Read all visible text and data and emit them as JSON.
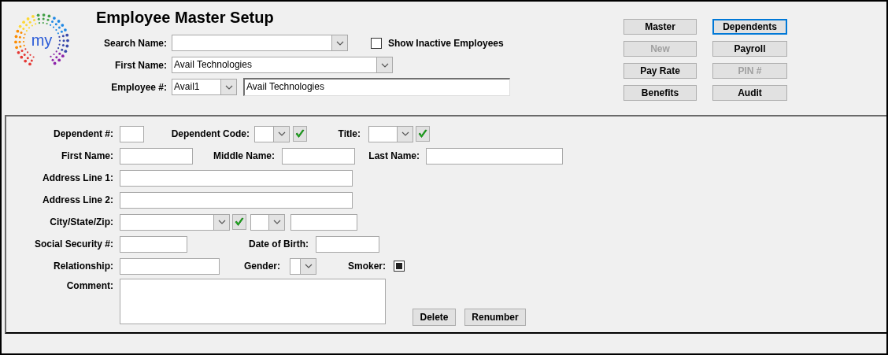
{
  "logo": {
    "text": "my"
  },
  "title": "Employee Master Setup",
  "search": {
    "label": "Search Name:"
  },
  "show_inactive": {
    "label": "Show Inactive Employees",
    "checked": false
  },
  "first_name": {
    "label": "First Name:",
    "value": "Avail Technologies"
  },
  "employee": {
    "label": "Employee #:",
    "value": "Avail1",
    "name_value": "Avail Technologies"
  },
  "buttons": [
    {
      "label": "Master",
      "disabled": false,
      "focused": false
    },
    {
      "label": "Dependents",
      "disabled": false,
      "focused": true
    },
    {
      "label": "New",
      "disabled": true,
      "focused": false
    },
    {
      "label": "Payroll",
      "disabled": false,
      "focused": false
    },
    {
      "label": "Pay Rate",
      "disabled": false,
      "focused": false
    },
    {
      "label": "PIN #",
      "disabled": true,
      "focused": false
    },
    {
      "label": "Benefits",
      "disabled": false,
      "focused": false
    },
    {
      "label": "Audit",
      "disabled": false,
      "focused": false
    }
  ],
  "form_rows": [
    [
      {
        "kind": "label",
        "text": "Dependent #:"
      },
      {
        "kind": "text"
      },
      {
        "kind": "label",
        "text": "Dependent Code:"
      },
      {
        "kind": "combo"
      },
      {
        "kind": "check"
      },
      {
        "kind": "label",
        "text": "Title:"
      },
      {
        "kind": "combo"
      },
      {
        "kind": "check"
      }
    ],
    [
      {
        "kind": "label",
        "text": "First Name:"
      },
      {
        "kind": "text"
      },
      {
        "kind": "label",
        "text": "Middle Name:"
      },
      {
        "kind": "text"
      },
      {
        "kind": "label",
        "text": "Last Name:"
      },
      {
        "kind": "text"
      }
    ],
    [
      {
        "kind": "label",
        "text": "Address Line 1:"
      },
      {
        "kind": "text"
      }
    ],
    [
      {
        "kind": "label",
        "text": "Address Line 2:"
      },
      {
        "kind": "text"
      }
    ],
    [
      {
        "kind": "label",
        "text": "City/State/Zip:"
      },
      {
        "kind": "combo"
      },
      {
        "kind": "check"
      },
      {
        "kind": "combo"
      },
      {
        "kind": "text"
      }
    ],
    [
      {
        "kind": "label",
        "text": "Social Security #:"
      },
      {
        "kind": "text"
      },
      {
        "kind": "label",
        "text": "Date of Birth:"
      },
      {
        "kind": "text"
      }
    ],
    [
      {
        "kind": "label",
        "text": "Relationship:"
      },
      {
        "kind": "text"
      },
      {
        "kind": "label",
        "text": "Gender:"
      },
      {
        "kind": "combo"
      },
      {
        "kind": "label",
        "text": "Smoker:"
      },
      {
        "kind": "checkbox",
        "checked": true
      }
    ],
    [
      {
        "kind": "label",
        "text": "Comment:"
      },
      {
        "kind": "textarea"
      },
      {
        "kind": "button",
        "text": "Delete"
      },
      {
        "kind": "button",
        "text": "Renumber"
      }
    ]
  ]
}
